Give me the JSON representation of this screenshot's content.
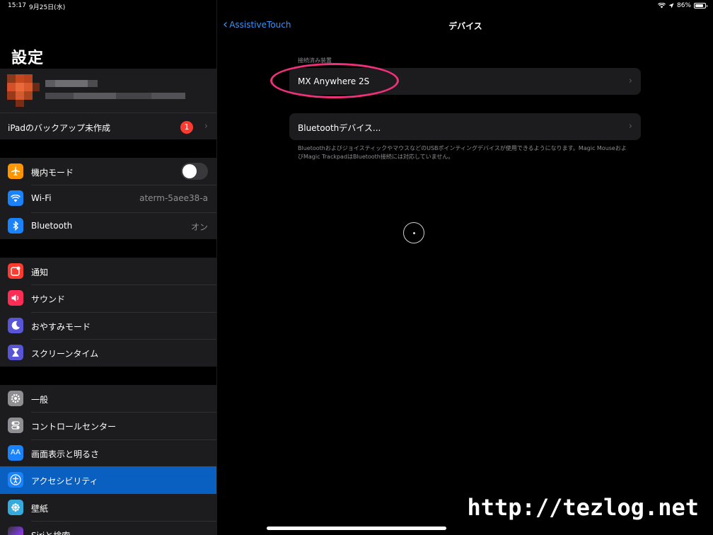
{
  "status_bar": {
    "time": "15:17",
    "date": "9月25日(水)",
    "battery_percent": "86%",
    "battery_level": 0.86
  },
  "sidebar": {
    "title": "設定",
    "backup": {
      "label": "iPadのバックアップ未作成",
      "badge": "1"
    },
    "groups": [
      [
        {
          "label": "機内モード",
          "icon": "airplane-icon",
          "color": "#ff9500",
          "toggle": false
        },
        {
          "label": "Wi-Fi",
          "icon": "wifi-icon",
          "color": "#1a82fb",
          "value": "aterm-5aee38-a"
        },
        {
          "label": "Bluetooth",
          "icon": "bluetooth-icon",
          "color": "#1a82fb",
          "value": "オン"
        }
      ],
      [
        {
          "label": "通知",
          "icon": "notifications-icon",
          "color": "#ff3b30"
        },
        {
          "label": "サウンド",
          "icon": "sound-icon",
          "color": "#ff2d55"
        },
        {
          "label": "おやすみモード",
          "icon": "moon-icon",
          "color": "#5856d6"
        },
        {
          "label": "スクリーンタイム",
          "icon": "hourglass-icon",
          "color": "#5856d6"
        }
      ],
      [
        {
          "label": "一般",
          "icon": "gear-icon",
          "color": "#8e8e93"
        },
        {
          "label": "コントロールセンター",
          "icon": "control-center-icon",
          "color": "#8e8e93"
        },
        {
          "label": "画面表示と明るさ",
          "icon": "display-icon",
          "color": "#1a82fb"
        },
        {
          "label": "アクセシビリティ",
          "icon": "accessibility-icon",
          "color": "#1a82fb",
          "selected": true
        },
        {
          "label": "壁紙",
          "icon": "wallpaper-icon",
          "color": "#35aadc"
        },
        {
          "label": "Siriと検索",
          "icon": "siri-icon",
          "color": "#333333"
        }
      ]
    ]
  },
  "detail": {
    "back_label": "AssistiveTouch",
    "title": "デバイス",
    "section_header": "接続済み装置",
    "connected_device": "MX Anywhere 2S",
    "bluetooth_devices": "Bluetoothデバイス...",
    "footer": "BluetoothおよびジョイスティックやマウスなどのUSBポインティングデバイスが使用できるようになります。Magic MouseおよびMagic TrackpadはBluetooth接続には対応していません。",
    "highlight_color": "#f0307a"
  },
  "watermark": "http://tezlog.net"
}
